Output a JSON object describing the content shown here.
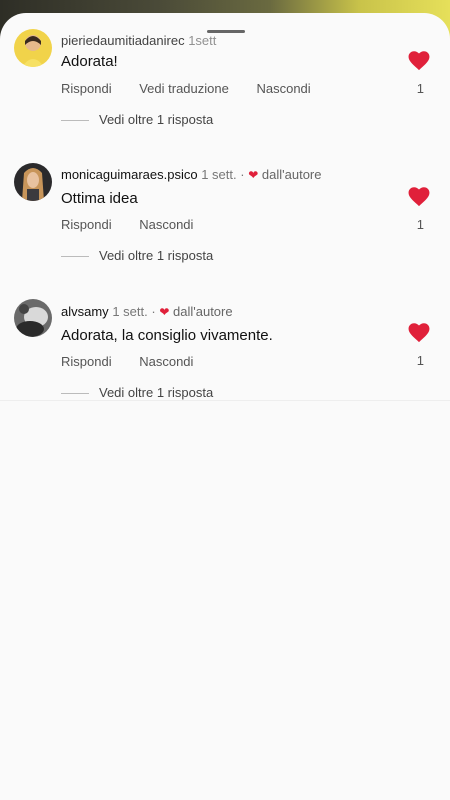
{
  "comments": [
    {
      "username": "pieriedaumitiadanirec",
      "time": "1sett",
      "author_liked": false,
      "text": "Adorata!",
      "actions": [
        "Rispondi",
        "Vedi traduzione",
        "Nascondi"
      ],
      "likes": "1",
      "replies_label": "Vedi oltre 1 risposta"
    },
    {
      "username": "monicaguimaraes.psico",
      "time": "1 sett.",
      "author_liked": true,
      "author_like_label": "dall'autore",
      "text": "Ottima idea",
      "actions": [
        "Rispondi",
        "Nascondi"
      ],
      "likes": "1",
      "replies_label": "Vedi oltre 1 risposta"
    },
    {
      "username": "alvsamy",
      "time": "1 sett.",
      "author_liked": true,
      "author_like_label": "dall'autore",
      "text": "Adorata, la consiglio vivamente.",
      "actions": [
        "Rispondi",
        "Nascondi"
      ],
      "likes": "1",
      "replies_label": "Vedi oltre 1 risposta"
    }
  ],
  "colors": {
    "heart": "#e0203a",
    "sheet": "#fafafa"
  },
  "icons": {
    "like": "heart-icon",
    "author_like": "small-heart-icon"
  }
}
